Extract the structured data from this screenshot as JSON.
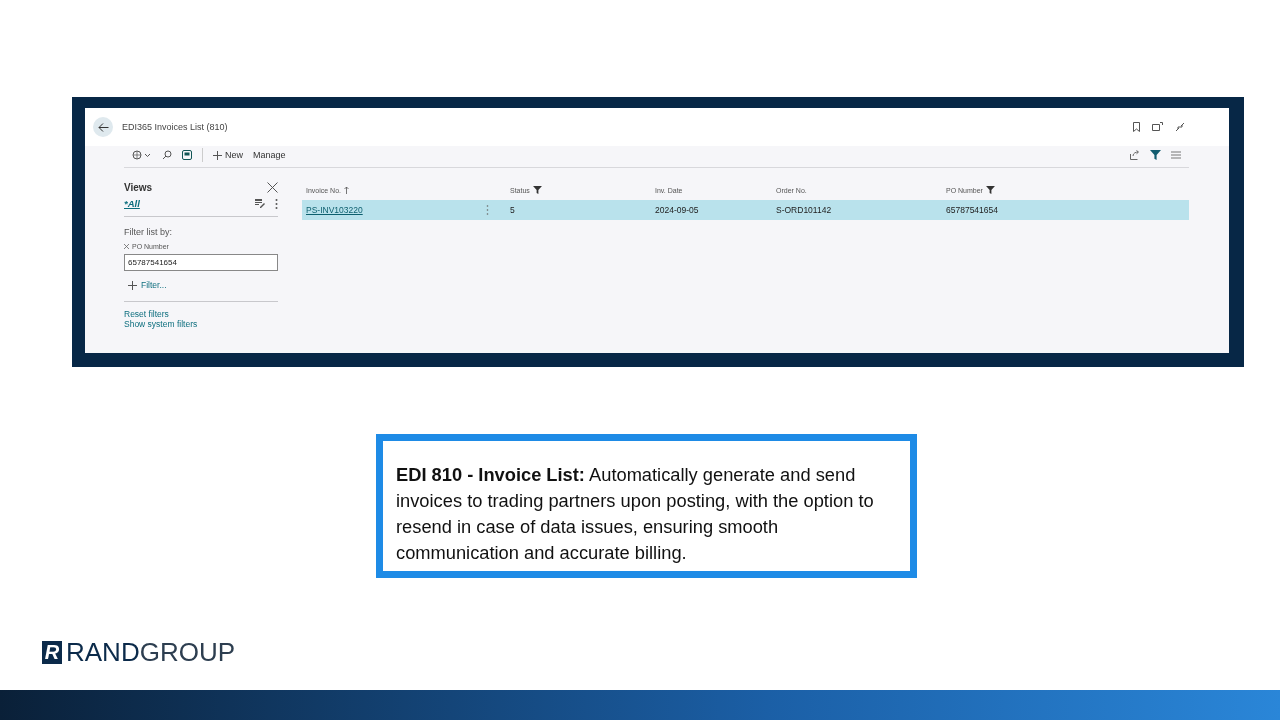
{
  "window": {
    "title": "EDI365 Invoices List (810)"
  },
  "toolbar": {
    "new": "New",
    "manage": "Manage"
  },
  "views": {
    "title": "Views",
    "items": [
      {
        "label": "*All",
        "selected": true
      }
    ]
  },
  "filters": {
    "label": "Filter list by:",
    "field": {
      "name": "PO Number",
      "value": "65787541654"
    },
    "add": "Filter...",
    "reset": "Reset filters",
    "system": "Show system filters"
  },
  "table": {
    "columns": [
      {
        "label": "Invoice No.",
        "sorted": true,
        "filtered": false
      },
      {
        "label": "Status",
        "sorted": false,
        "filtered": true
      },
      {
        "label": "Inv. Date",
        "sorted": false,
        "filtered": false
      },
      {
        "label": "Order No.",
        "sorted": false,
        "filtered": false
      },
      {
        "label": "PO Number",
        "sorted": false,
        "filtered": true
      }
    ],
    "rows": [
      {
        "selected": true,
        "cells": [
          "PS-INV103220",
          "5",
          "2024-09-05",
          "S-ORD101142",
          "65787541654"
        ]
      }
    ]
  },
  "caption": "**EDI 810 - Invoice List:** Automatically generate and send invoices to trading partners upon posting, with the option to resend in case of data issues, ensuring smooth communication and accurate billing.",
  "logo": {
    "mark": "R",
    "first": "RAND",
    "second": "GROUP"
  }
}
